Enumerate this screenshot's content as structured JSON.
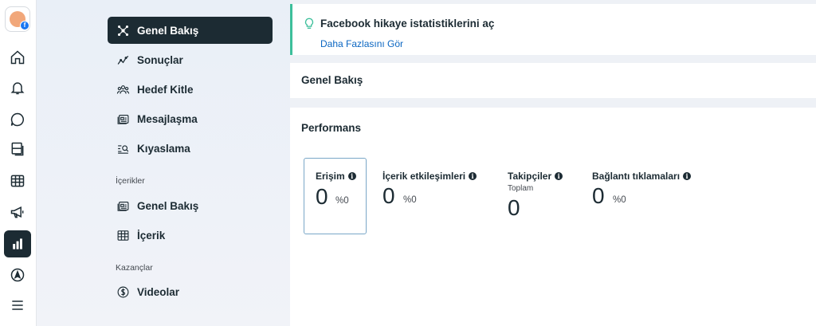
{
  "rail": {
    "items": [
      {
        "name": "home-icon"
      },
      {
        "name": "bell-icon"
      },
      {
        "name": "chat-icon"
      },
      {
        "name": "pages-icon"
      },
      {
        "name": "table-icon"
      },
      {
        "name": "megaphone-icon"
      },
      {
        "name": "insights-icon",
        "active": true
      },
      {
        "name": "navigation-icon"
      },
      {
        "name": "menu-icon"
      }
    ]
  },
  "nav": {
    "items": [
      {
        "label": "Genel Bakış",
        "icon": "overview-icon",
        "active": true
      },
      {
        "label": "Sonuçlar",
        "icon": "results-icon"
      },
      {
        "label": "Hedef Kitle",
        "icon": "audience-icon"
      },
      {
        "label": "Mesajlaşma",
        "icon": "messaging-icon"
      },
      {
        "label": "Kıyaslama",
        "icon": "benchmark-icon"
      }
    ],
    "content_section": "İçerikler",
    "content_items": [
      {
        "label": "Genel Bakış",
        "icon": "content-overview-icon"
      },
      {
        "label": "İçerik",
        "icon": "content-table-icon"
      }
    ],
    "earnings_section": "Kazançlar",
    "earnings_items": [
      {
        "label": "Videolar",
        "icon": "dollar-icon"
      }
    ]
  },
  "tip": {
    "title": "Facebook hikaye istatistiklerini aç",
    "link": "Daha Fazlasını Gör"
  },
  "overview_title": "Genel Bakış",
  "performance": {
    "title": "Performans",
    "metrics": [
      {
        "label": "Erişim",
        "value": "0",
        "change": "%0",
        "selected": true
      },
      {
        "label": "İçerik etkileşimleri",
        "value": "0",
        "change": "%0"
      },
      {
        "label": "Takipçiler",
        "sub": "Toplam",
        "value": "0"
      },
      {
        "label": "Bağlantı tıklamaları",
        "value": "0",
        "change": "%0"
      }
    ]
  },
  "colors": {
    "accent_dark": "#1c2b33",
    "link": "#0a66c2",
    "tip_border": "#3dbf9b"
  }
}
